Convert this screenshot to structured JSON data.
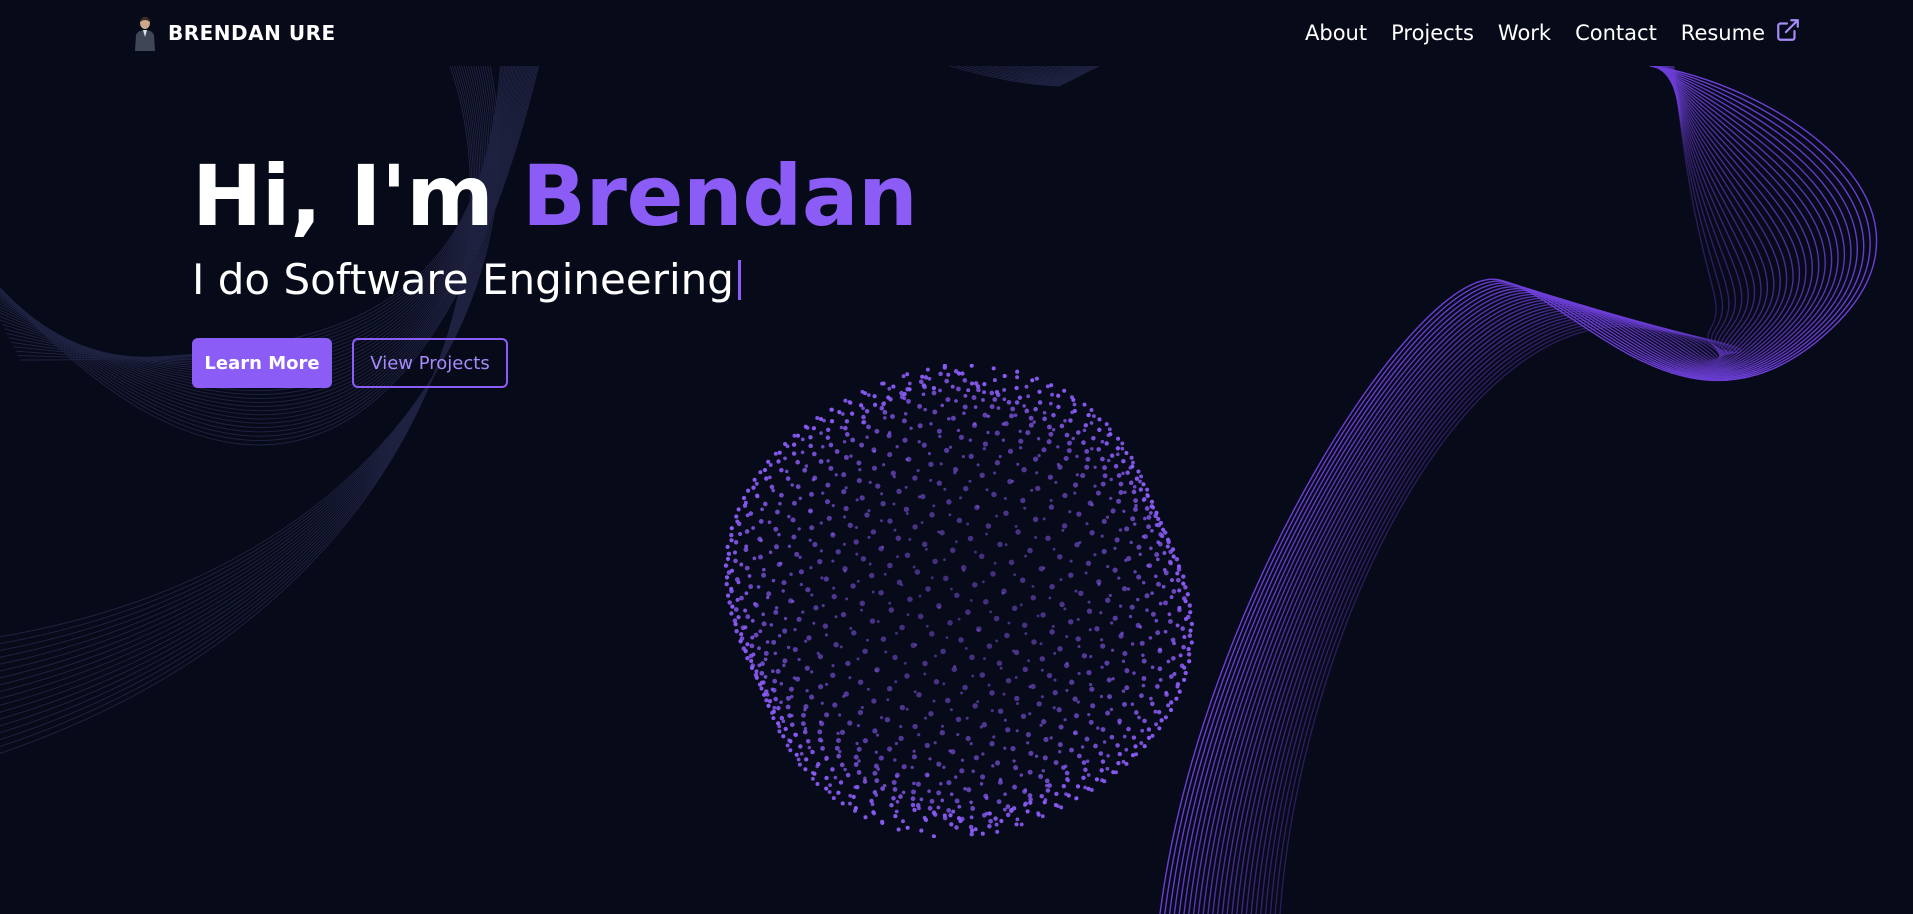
{
  "brand": {
    "name": "BRENDAN URE",
    "avatar_icon": "person-avatar-icon"
  },
  "nav": {
    "items": [
      {
        "label": "About"
      },
      {
        "label": "Projects"
      },
      {
        "label": "Work"
      },
      {
        "label": "Contact"
      },
      {
        "label": "Resume",
        "icon": "external-link-icon"
      }
    ]
  },
  "hero": {
    "greeting": "Hi, I'm",
    "name": "Brendan",
    "subtitle": "I do Software Engineering"
  },
  "cta": {
    "primary_label": "Learn More",
    "secondary_label": "View Projects"
  },
  "colors": {
    "background": "#070a18",
    "accent": "#8b5cf6",
    "accent_light": "#a78bfa",
    "text": "#ffffff",
    "faint_line": "#2a2c52"
  }
}
